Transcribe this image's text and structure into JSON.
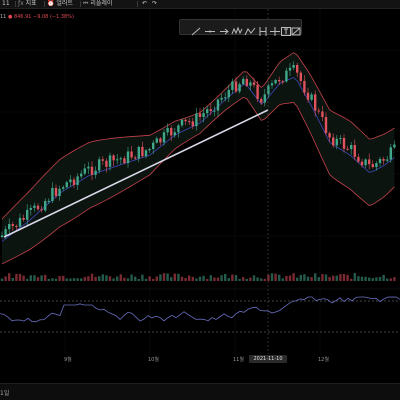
{
  "toolbar": {
    "items": [
      {
        "label": "11",
        "icon": "interval-label"
      },
      {
        "label": "지표",
        "icon": "indicators-icon"
      },
      {
        "label": "얼러트",
        "icon": "alert-icon"
      },
      {
        "label": "리플레이",
        "icon": "replay-icon"
      }
    ],
    "undo_icon": "undo-icon",
    "redo_icon": "redo-icon"
  },
  "legend": {
    "prefix": "11",
    "price": "846.91",
    "change": "−9.08 (−1.38%)"
  },
  "drawing_tools": [
    {
      "icon": "trend-line-icon"
    },
    {
      "icon": "horizontal-line-icon"
    },
    {
      "icon": "arrow-icon"
    },
    {
      "icon": "pattern-icon"
    },
    {
      "icon": "projection-icon"
    },
    {
      "icon": "price-range-icon"
    },
    {
      "icon": "crosshair-icon"
    },
    {
      "icon": "text-icon"
    },
    {
      "icon": "brush-icon"
    }
  ],
  "x_axis": {
    "labels": [
      "9월",
      "10월",
      "11월",
      "12월"
    ],
    "crosshair_date": "2021-11-10"
  },
  "status_bar": {
    "text": "1일"
  },
  "colors": {
    "up": "#3fa88a",
    "down": "#e0525d",
    "bollinger": "#c4424c",
    "midline": "#3f47b8",
    "oscillator": "#6a6fc0",
    "background": "#000000"
  }
}
